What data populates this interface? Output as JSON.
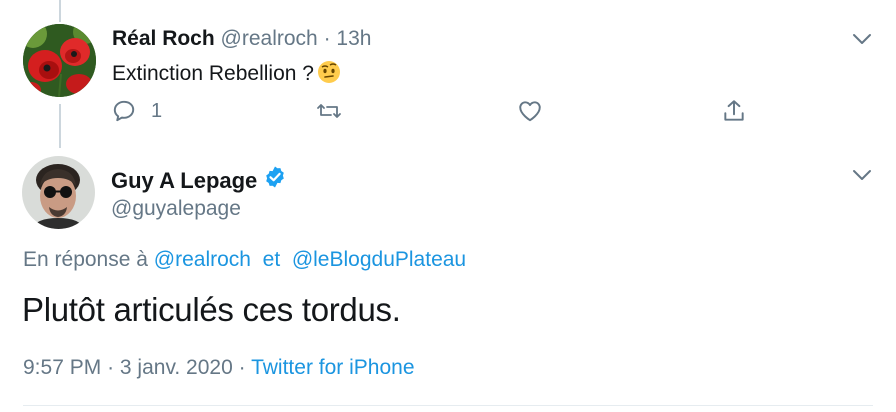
{
  "reply_tweet": {
    "author_name": "Réal Roch",
    "handle": "@realroch",
    "separator": "·",
    "time_ago": "13h",
    "text": "Extinction Rebellion ?",
    "emoji": "face-with-raised-eyebrow-icon",
    "reply_count": "1"
  },
  "main_tweet": {
    "author_name": "Guy A Lepage",
    "handle": "@guyalepage",
    "verified": true,
    "reply_to_prefix": "En réponse à",
    "reply_to_user_1": "@realroch",
    "reply_to_joiner": "et",
    "reply_to_user_2": "@leBlogduPlateau",
    "text": "Plutôt articulés ces tordus.",
    "time": "9:57 PM",
    "dot": "·",
    "date": "3 janv. 2020",
    "source": "Twitter for iPhone"
  },
  "colors": {
    "link": "#1b95e0",
    "muted": "#657786",
    "text": "#14171a",
    "verified": "#1da1f2",
    "divider": "#e6ecf0"
  }
}
